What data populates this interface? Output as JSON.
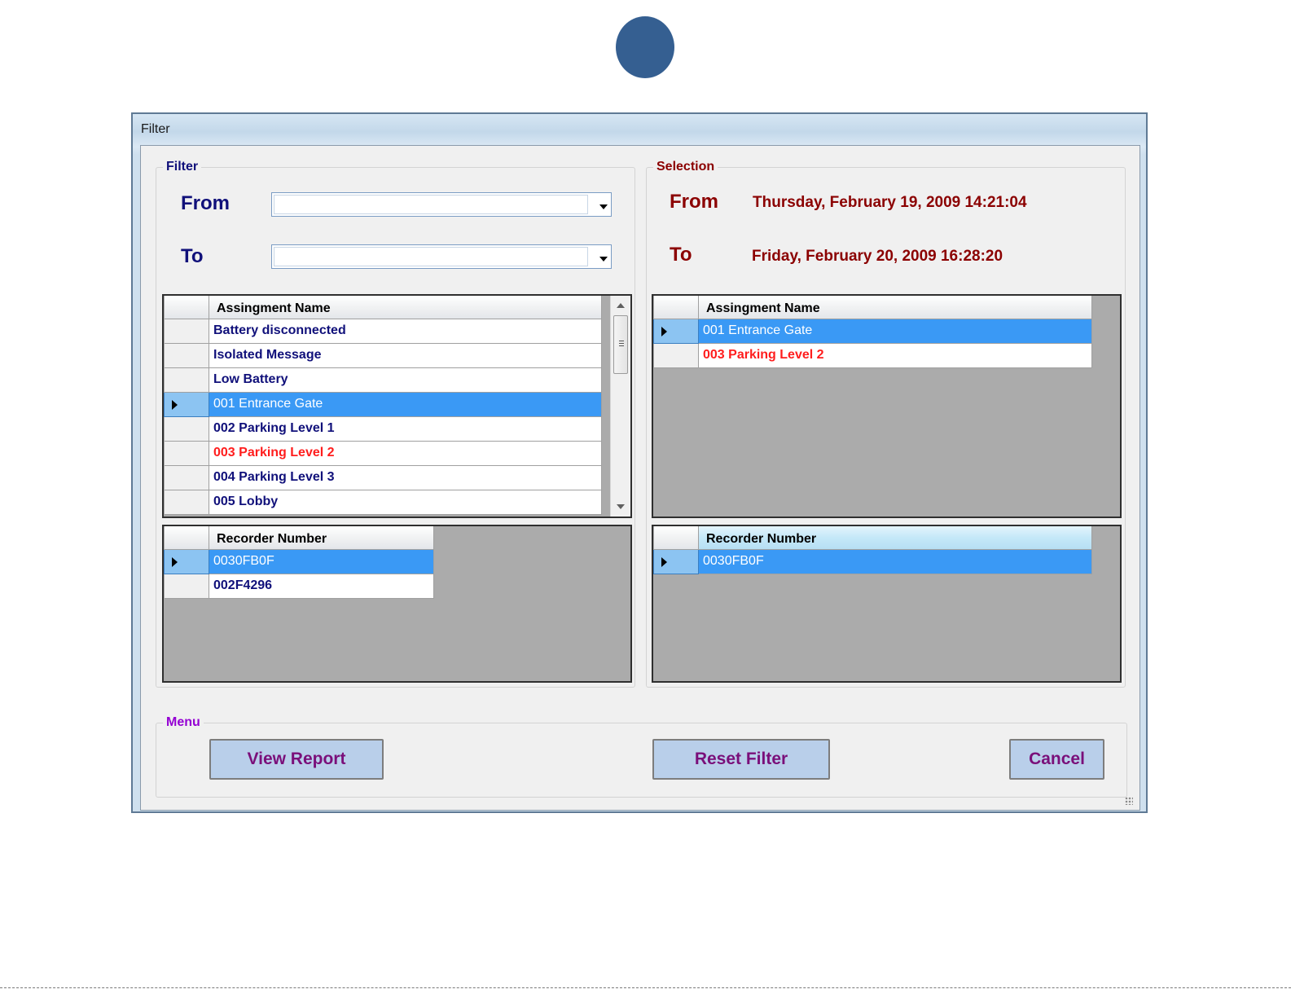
{
  "window": {
    "title": "Filter"
  },
  "filter_group": {
    "label": "Filter",
    "from_label": "From",
    "to_label": "To",
    "from_value": "",
    "to_value": "",
    "assignments": {
      "header": "Assingment Name",
      "rows": [
        {
          "name": "Battery disconnected",
          "selected": false,
          "red": false
        },
        {
          "name": "Isolated Message",
          "selected": false,
          "red": false
        },
        {
          "name": "Low Battery",
          "selected": false,
          "red": false
        },
        {
          "name": "001 Entrance Gate",
          "selected": true,
          "red": false
        },
        {
          "name": "002 Parking Level 1",
          "selected": false,
          "red": false
        },
        {
          "name": "003 Parking Level 2",
          "selected": false,
          "red": true
        },
        {
          "name": "004 Parking Level 3",
          "selected": false,
          "red": false
        },
        {
          "name": "005 Lobby",
          "selected": false,
          "red": false
        }
      ]
    },
    "recorders": {
      "header": "Recorder Number",
      "rows": [
        {
          "name": "0030FB0F",
          "selected": true
        },
        {
          "name": "002F4296",
          "selected": false
        }
      ]
    }
  },
  "selection_group": {
    "label": "Selection",
    "from_label": "From",
    "to_label": "To",
    "from_value": "Thursday, February 19, 2009 14:21:04",
    "to_value": "Friday, February 20, 2009 16:28:20",
    "assignments": {
      "header": "Assingment Name",
      "rows": [
        {
          "name": "001 Entrance Gate",
          "selected": true,
          "red": false
        },
        {
          "name": "003 Parking Level 2",
          "selected": false,
          "red": true
        }
      ]
    },
    "recorders": {
      "header": "Recorder Number",
      "rows": [
        {
          "name": "0030FB0F",
          "selected": true
        }
      ]
    }
  },
  "menu_group": {
    "label": "Menu",
    "view_report": "View Report",
    "reset_filter": "Reset Filter",
    "cancel": "Cancel"
  },
  "colors": {
    "badge_circle": "#355f91",
    "label_blue": "#10107a",
    "label_red": "#8b0000",
    "menu_purple": "#9400d3",
    "selected_row": "#3a99f5",
    "button_face": "#b9cfea"
  }
}
